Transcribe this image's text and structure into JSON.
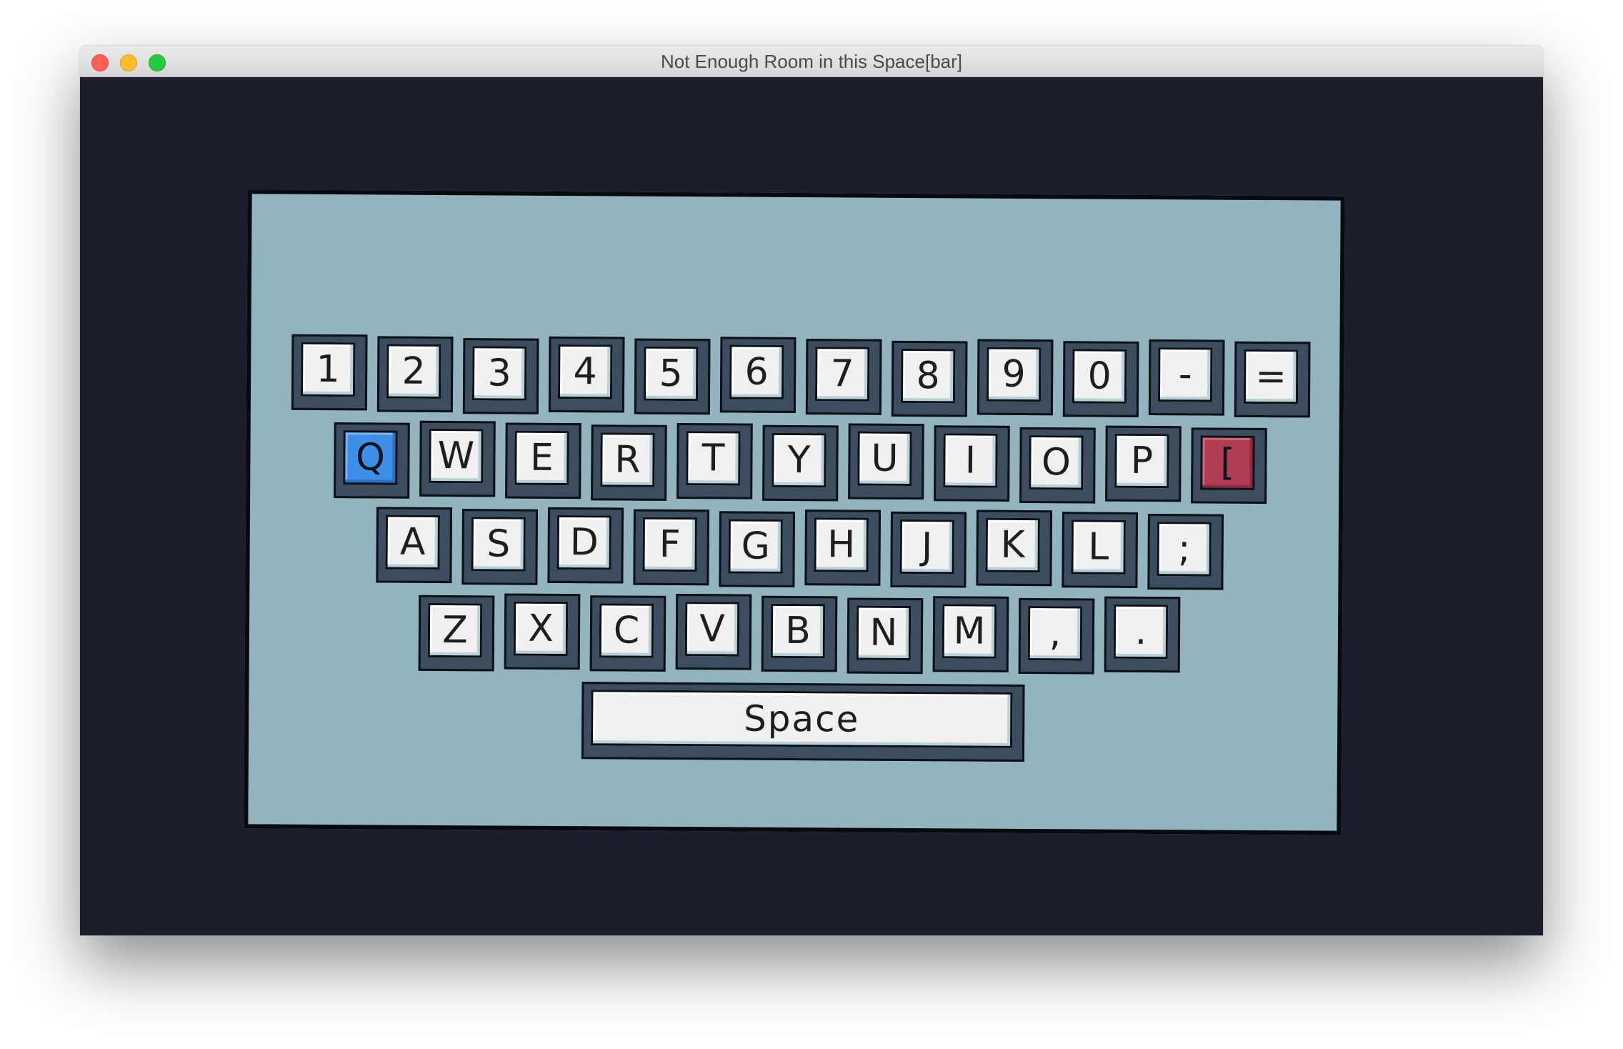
{
  "window": {
    "title": "Not Enough Room in this Space[bar]"
  },
  "keyboard": {
    "rows": [
      [
        "1",
        "2",
        "3",
        "4",
        "5",
        "6",
        "7",
        "8",
        "9",
        "0",
        "-",
        "="
      ],
      [
        "Q",
        "W",
        "E",
        "R",
        "T",
        "Y",
        "U",
        "I",
        "O",
        "P",
        "["
      ],
      [
        "A",
        "S",
        "D",
        "F",
        "G",
        "H",
        "J",
        "K",
        "L",
        ";"
      ],
      [
        "Z",
        "X",
        "C",
        "V",
        "B",
        "N",
        "M",
        ",",
        "."
      ]
    ],
    "space_label": "Space",
    "active_key": "Q",
    "blocked_key": "["
  },
  "colors": {
    "background": "#1c1e2b",
    "board": "#93b4bf",
    "keycap": "#f0f0f0",
    "key_frame": "#3b4d5e",
    "active_key": "#3f8ee8",
    "blocked_key": "#b23c54"
  }
}
